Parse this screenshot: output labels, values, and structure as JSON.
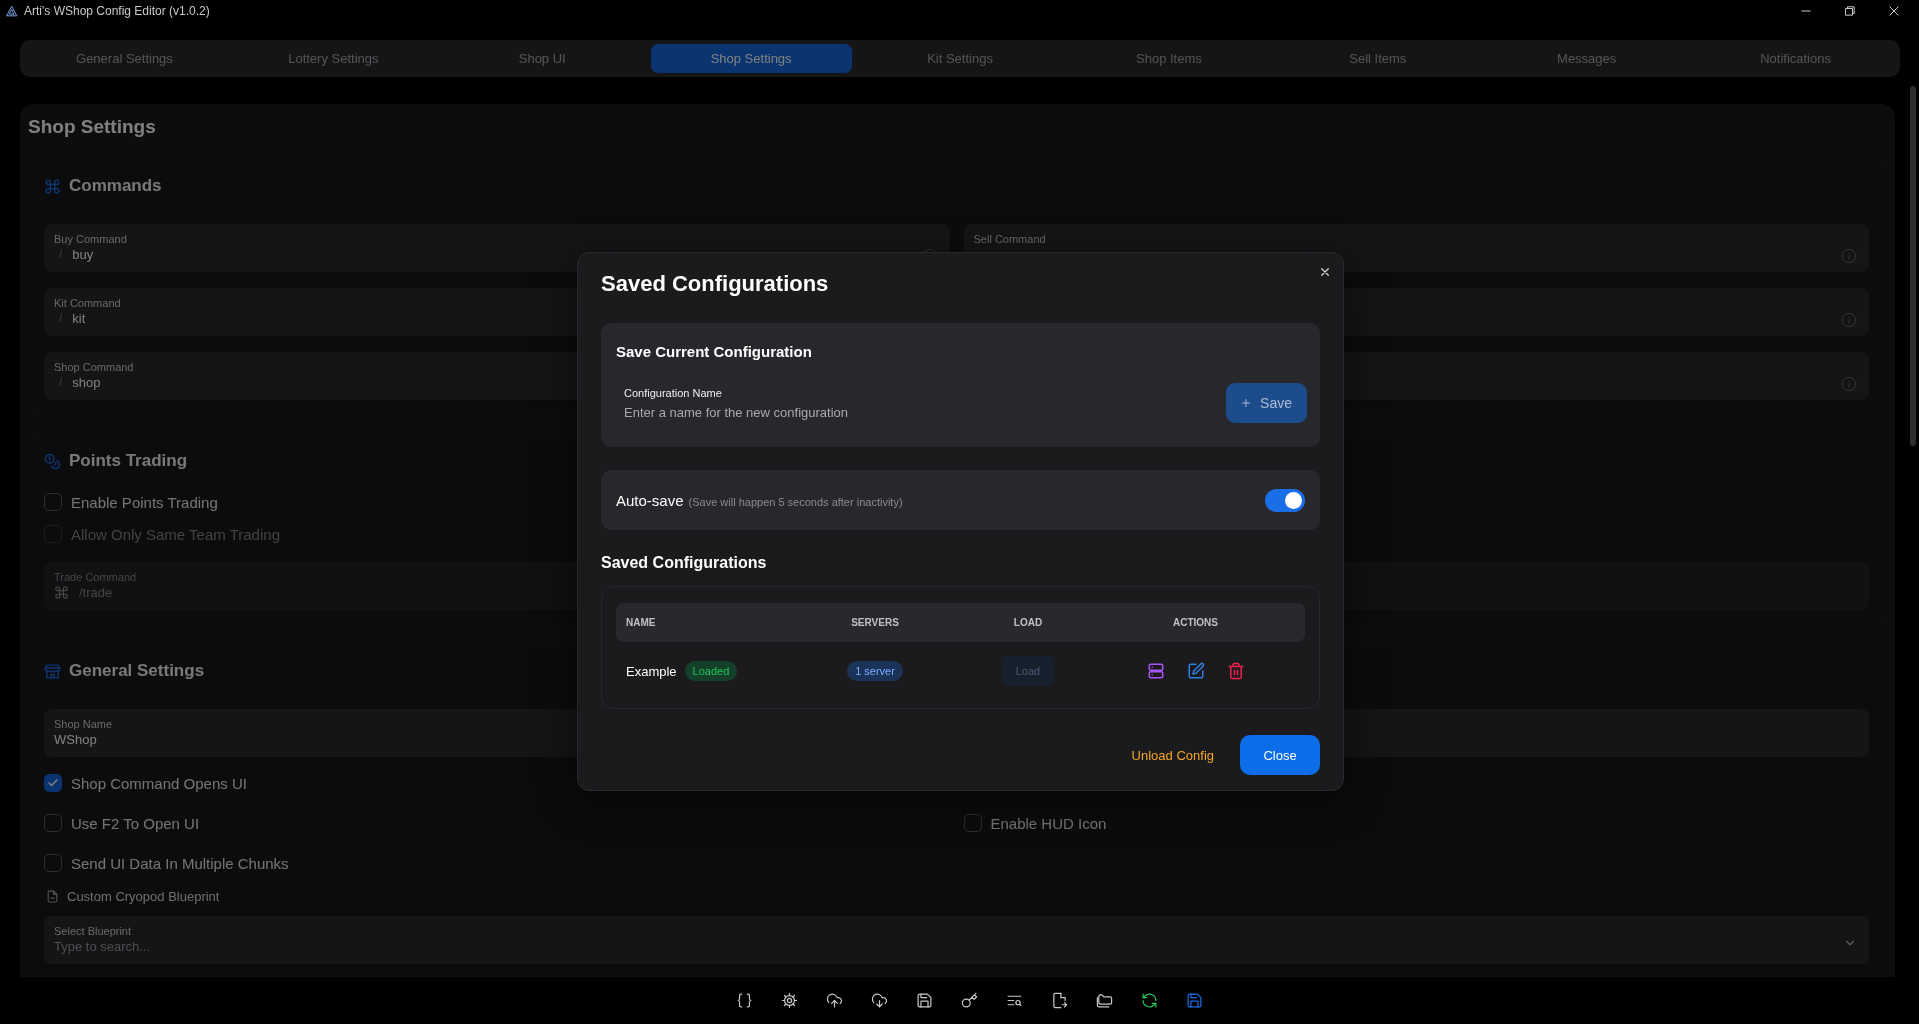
{
  "window": {
    "title": "Arti's WShop Config Editor (v1.0.2)"
  },
  "tabs": [
    {
      "label": "General Settings",
      "selected": false
    },
    {
      "label": "Lottery Settings",
      "selected": false
    },
    {
      "label": "Shop UI",
      "selected": false
    },
    {
      "label": "Shop Settings",
      "selected": true
    },
    {
      "label": "Kit Settings",
      "selected": false
    },
    {
      "label": "Shop Items",
      "selected": false
    },
    {
      "label": "Sell Items",
      "selected": false
    },
    {
      "label": "Messages",
      "selected": false
    },
    {
      "label": "Notifications",
      "selected": false
    }
  ],
  "page_title": "Shop Settings",
  "sections": [
    {
      "title": "Commands",
      "rows": [
        [
          {
            "kind": "field",
            "label": "Buy Command",
            "prefix": "/",
            "value": "buy",
            "info": true
          },
          {
            "kind": "field",
            "label": "Sell Command",
            "info": true
          }
        ],
        [
          {
            "kind": "field",
            "label": "Kit Command",
            "prefix": "/",
            "value": "kit"
          },
          {
            "kind": "field",
            "info": true
          }
        ],
        [
          {
            "kind": "field",
            "label": "Shop Command",
            "prefix": "/",
            "value": "shop"
          },
          {
            "kind": "field",
            "info": true
          }
        ]
      ]
    },
    {
      "title": "Points Trading",
      "rows": [
        [
          {
            "kind": "checkbox",
            "label": "Enable Points Trading",
            "checked": false,
            "disabled": false
          }
        ],
        [
          {
            "kind": "checkbox",
            "label": "Allow Only Same Team Trading",
            "checked": false,
            "disabled": true
          }
        ],
        [
          {
            "kind": "wide_field",
            "label": "Trade Command",
            "value": "/trade",
            "command_prefix": true,
            "disabled": true
          }
        ]
      ]
    },
    {
      "title": "General Settings",
      "rows": [
        [
          {
            "kind": "wide_field",
            "label": "Shop Name",
            "value": "WShop"
          }
        ],
        [
          {
            "kind": "checkbox",
            "label": "Shop Command Opens UI",
            "checked": true,
            "disabled": false
          }
        ],
        [
          {
            "kind": "checkbox",
            "label": "Use F2 To Open UI",
            "checked": false,
            "disabled": false
          },
          {
            "kind": "checkbox",
            "label": "Enable HUD Icon",
            "checked": false,
            "disabled": false
          }
        ],
        [
          {
            "kind": "checkbox",
            "label": "Send UI Data In Multiple Chunks",
            "checked": false,
            "disabled": false
          }
        ],
        [
          {
            "kind": "file_label",
            "label": "Custom Cryopod Blueprint"
          }
        ],
        [
          {
            "kind": "select",
            "label": "Select Blueprint",
            "placeholder": "Type to search..."
          }
        ]
      ]
    }
  ],
  "modal": {
    "title": "Saved Configurations",
    "save_panel": {
      "title": "Save Current Configuration",
      "field_label": "Configuration Name",
      "placeholder": "Enter a name for the new configuration",
      "button": "Save"
    },
    "autosave": {
      "label": "Auto-save",
      "hint": "(Save will happen 5 seconds after inactivity)",
      "on": true
    },
    "list_title": "Saved Configurations",
    "table": {
      "columns": [
        "NAME",
        "SERVERS",
        "LOAD",
        "ACTIONS"
      ],
      "rows": [
        {
          "name": "Example",
          "badge": "Loaded",
          "servers": "1 server",
          "load": "Load",
          "load_disabled": true
        }
      ]
    },
    "footer": {
      "unload": "Unload Config",
      "close": "Close"
    }
  }
}
